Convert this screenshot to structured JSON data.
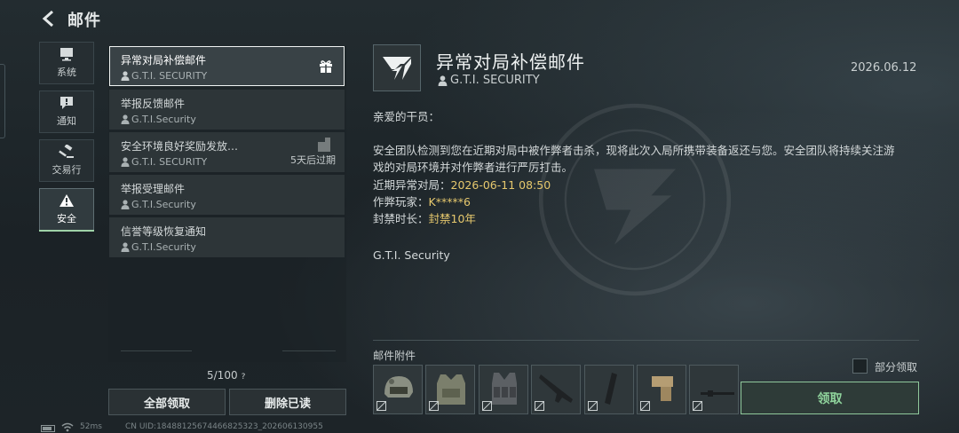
{
  "header": {
    "title": "邮件"
  },
  "categories": [
    {
      "label": "系统",
      "icon": "monitor-icon"
    },
    {
      "label": "通知",
      "icon": "alert-bubble-icon"
    },
    {
      "label": "交易行",
      "icon": "gavel-icon"
    },
    {
      "label": "安全",
      "icon": "warning-icon",
      "active": true
    }
  ],
  "mails": [
    {
      "title": "异常对局补偿邮件",
      "sender": "G.T.I. SECURITY",
      "icon": "gift-icon",
      "selected": true
    },
    {
      "title": "举报反馈邮件",
      "sender": "G.T.I.Security"
    },
    {
      "title": "安全环境良好奖励发放…",
      "sender": "G.T.I. SECURITY",
      "expire": "5天后过期",
      "icon": "crate-icon"
    },
    {
      "title": "举报受理邮件",
      "sender": "G.T.I.Security"
    },
    {
      "title": "信誉等级恢复通知",
      "sender": "G.T.I.Security"
    }
  ],
  "list_footer": {
    "count": "5/100",
    "help": "?",
    "claim_all": "全部领取",
    "delete_read": "删除已读"
  },
  "status_bar": {
    "ping": "52ms",
    "uid": "CN UID:18488125674466825323_202606130955"
  },
  "detail": {
    "title": "异常对局补偿邮件",
    "sender": "G.T.I. SECURITY",
    "date": "2026.06.12",
    "greeting": "亲爱的干员：",
    "paragraph": "安全团队检测到您在近期对局中被作弊者击杀，现将此次入局所携带装备返还与您。安全团队将持续关注游",
    "paragraph2": "戏的对局环境并对作弊者进行严厉打击。",
    "recent_label": "近期异常对局：",
    "recent_value": "2026-06-11 08:50",
    "cheater_label": "作弊玩家：",
    "cheater_value": "K*****6",
    "ban_label": "封禁时长：",
    "ban_value": "封禁10年",
    "signature": "G.T.I. Security"
  },
  "attachments": {
    "label": "邮件附件",
    "items": [
      "helmet-icon",
      "armor-vest-icon",
      "chest-rig-icon",
      "rifle-icon",
      "magazine-icon",
      "gun-grip-icon",
      "rifle-barrel-icon"
    ],
    "partial_label": "部分领取",
    "claim": "领取"
  },
  "colors": {
    "accent_green": "#8fd39c",
    "highlight_gold": "#e6c86d"
  }
}
